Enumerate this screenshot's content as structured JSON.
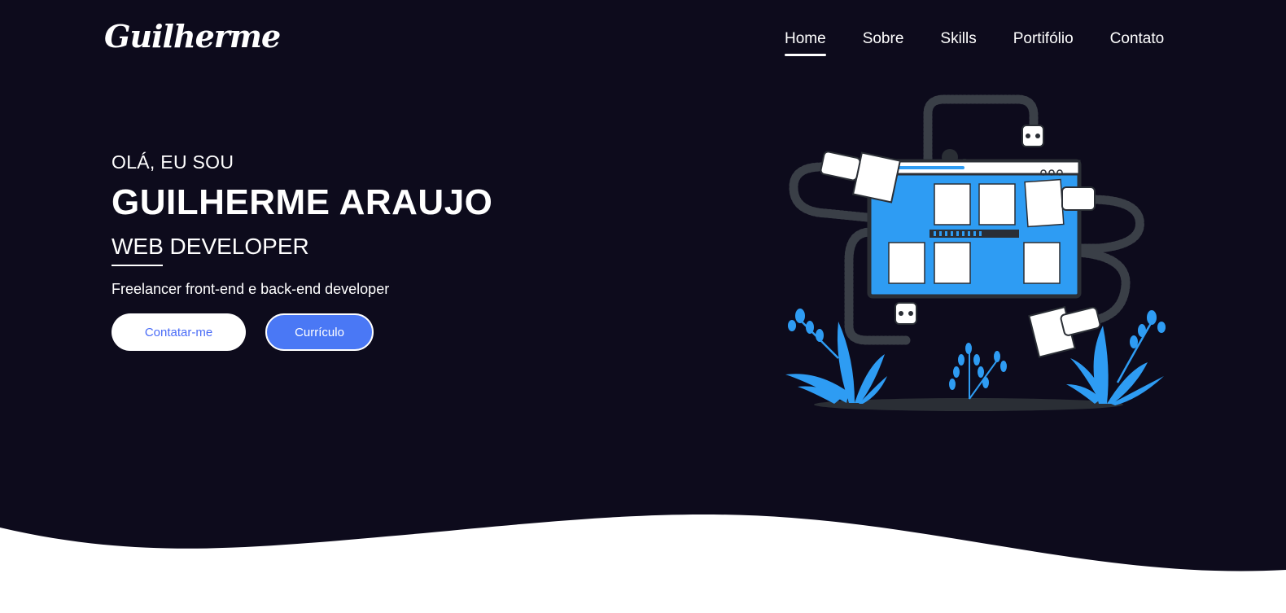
{
  "colors": {
    "background": "#0d0b1c",
    "accent": "#4a78f5",
    "illustration_blue": "#2e9cf3",
    "text": "#ffffff"
  },
  "header": {
    "logo": "Guilherme",
    "nav": [
      {
        "label": "Home",
        "active": true
      },
      {
        "label": "Sobre",
        "active": false
      },
      {
        "label": "Skills",
        "active": false
      },
      {
        "label": "Portifólio",
        "active": false
      },
      {
        "label": "Contato",
        "active": false
      }
    ]
  },
  "hero": {
    "greeting": "OLÁ, EU SOU",
    "name": "GUILHERME ARAUJO",
    "role": "WEB DEVELOPER",
    "tagline": "Freelancer front-end e back-end developer",
    "buttons": {
      "contact": "Contatar-me",
      "cv": "Currículo"
    }
  },
  "illustration": {
    "icon": "web-developer-illustration"
  }
}
